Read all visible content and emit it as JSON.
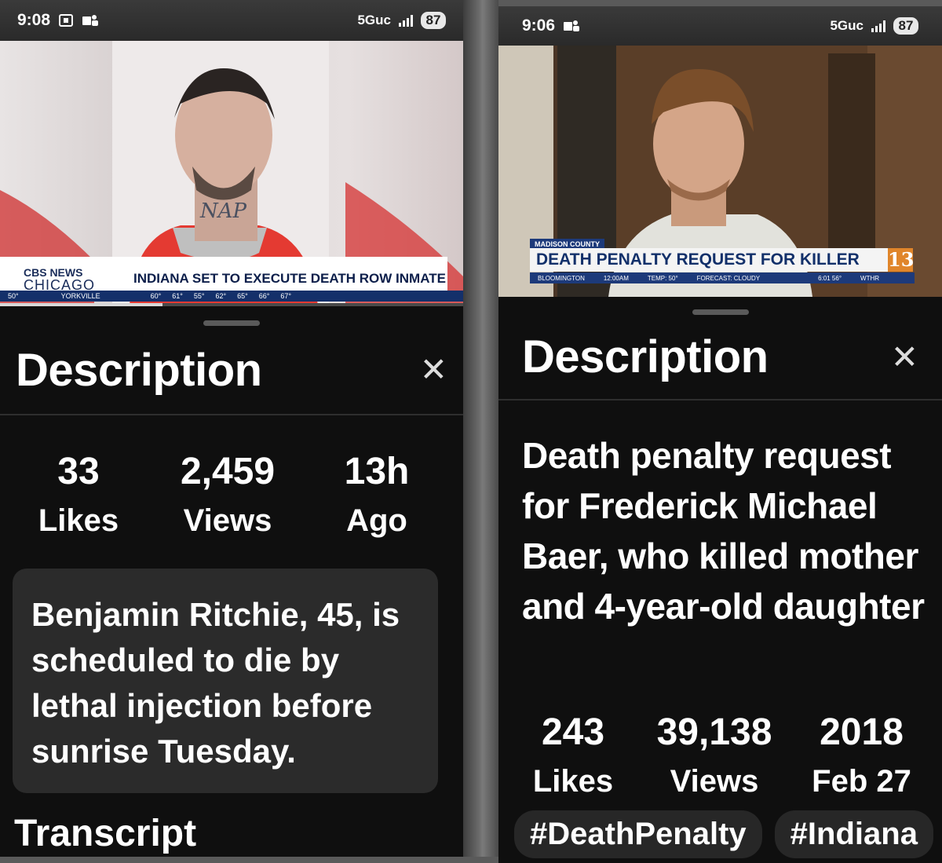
{
  "left": {
    "status": {
      "time": "9:08",
      "network": "5Guc",
      "battery": "87"
    },
    "video": {
      "logo_line1": "CBS NEWS",
      "logo_line2": "CHICAGO",
      "headline": "INDIANA SET TO EXECUTE DEATH ROW INMATE",
      "ticker_location": "YORKVILLE",
      "ticker_temp": "50°",
      "forecast": [
        "60°",
        "61°",
        "55°",
        "62°",
        "65°",
        "66°",
        "67°"
      ],
      "progress": 0.35
    },
    "sheet": {
      "title": "Description",
      "stats": [
        {
          "num": "33",
          "label": "Likes"
        },
        {
          "num": "2,459",
          "label": "Views"
        },
        {
          "num": "13h",
          "label": "Ago"
        }
      ],
      "description": "Benjamin Ritchie, 45, is scheduled to die by lethal injection before sunrise Tuesday.",
      "transcript_label": "Transcript"
    }
  },
  "right": {
    "status": {
      "time": "9:06",
      "network": "5Guc",
      "battery": "87"
    },
    "video": {
      "county": "MADISON COUNTY",
      "headline": "DEATH PENALTY REQUEST FOR KILLER",
      "channel": "13",
      "bar_location": "BLOOMINGTON",
      "bar_time": "12:00AM",
      "bar_temp": "TEMP: 50°",
      "bar_forecast": "FORECAST: CLOUDY",
      "bar_clock": "6:01 56°",
      "bar_station": "WTHR"
    },
    "sheet": {
      "title": "Description",
      "video_title": "Death penalty request for Frederick Michael Baer, who killed mother and 4-year-old daughter",
      "stats": [
        {
          "num": "243",
          "label": "Likes"
        },
        {
          "num": "39,138",
          "label": "Views"
        },
        {
          "num": "2018",
          "label": "Feb 27"
        }
      ],
      "tags": [
        "#DeathPenalty",
        "#Indiana"
      ]
    }
  }
}
